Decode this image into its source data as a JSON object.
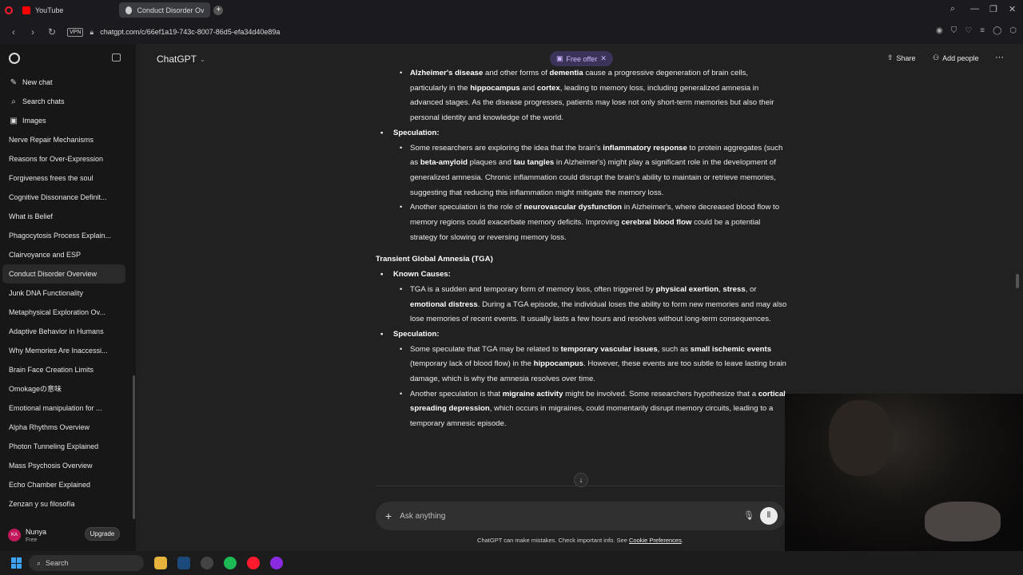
{
  "browser": {
    "tabs": [
      {
        "label": "YouTube",
        "active": false
      },
      {
        "label": "Conduct Disorder Overvie",
        "active": true
      }
    ],
    "new_tab": "+",
    "vpn_label": "VPN",
    "url": "chatgpt.com/c/66ef1a19-743c-8007-86d5-efa34d40e89a"
  },
  "sidebar": {
    "actions": [
      {
        "label": "New chat",
        "icon": "✎"
      },
      {
        "label": "Search chats",
        "icon": "⌕"
      },
      {
        "label": "Images",
        "icon": "▣"
      }
    ],
    "items": [
      "Nerve Repair Mechanisms",
      "Reasons for Over-Expression",
      "Forgiveness frees the soul",
      "Cognitive Dissonance Definit...",
      "What is Belief",
      "Phagocytosis Process Explain...",
      "Clairvoyance and ESP",
      "Conduct Disorder Overview",
      "Junk DNA Functionality",
      "Metaphysical Exploration Ov...",
      "Adaptive Behavior in Humans",
      "Why Memories Are Inaccessi...",
      "Brain Face Creation Limits",
      "Omokageの意味",
      "Emotional manipulation for ...",
      "Alpha Rhythms Overview",
      "Photon Tunneling Explained",
      "Mass Psychosis Overview",
      "Echo Chamber Explained",
      "Zenzan y su filosofía"
    ],
    "active_index": 7,
    "user": {
      "initials": "KA",
      "name": "Nunya",
      "plan": "Free"
    },
    "upgrade_label": "Upgrade"
  },
  "header": {
    "title": "ChatGPT",
    "offer_label": "Free offer",
    "share_label": "Share",
    "add_people_label": "Add people"
  },
  "content": {
    "known_causes_label": "Known Causes:",
    "speculation_label": "Speculation:",
    "alz_p1": "Alzheimer's disease",
    "alz_p2": " and other forms of ",
    "alz_p3": "dementia",
    "alz_p4": " cause a progressive degeneration of brain cells, particularly in the ",
    "alz_p5": "hippocampus",
    "alz_p6": " and ",
    "alz_p7": "cortex",
    "alz_p8": ", leading to memory loss, including generalized amnesia in advanced stages. As the disease progresses, patients may lose not only short-term memories but also their personal identity and knowledge of the world.",
    "spec1_p1": "Some researchers are exploring the idea that the brain's ",
    "spec1_p2": "inflammatory response",
    "spec1_p3": " to protein aggregates (such as ",
    "spec1_p4": "beta-amyloid",
    "spec1_p5": " plaques and ",
    "spec1_p6": "tau tangles",
    "spec1_p7": " in Alzheimer's) might play a significant role in the development of generalized amnesia. Chronic inflammation could disrupt the brain's ability to maintain or retrieve memories, suggesting that reducing this inflammation might mitigate the memory loss.",
    "spec2_p1": "Another speculation is the role of ",
    "spec2_p2": "neurovascular dysfunction",
    "spec2_p3": " in Alzheimer's, where decreased blood flow to memory regions could exacerbate memory deficits. Improving ",
    "spec2_p4": "cerebral blood flow",
    "spec2_p5": " could be a potential strategy for slowing or reversing memory loss.",
    "tga_heading": "Transient Global Amnesia (TGA)",
    "tga_p1": "TGA is a sudden and temporary form of memory loss, often triggered by ",
    "tga_p2": "physical exertion",
    "tga_p3": ", ",
    "tga_p4": "stress",
    "tga_p5": ", or ",
    "tga_p6": "emotional distress",
    "tga_p7": ". During a TGA episode, the individual loses the ability to form new memories and may also lose memories of recent events. It usually lasts a few hours and resolves without long-term consequences.",
    "tspec1_p1": "Some speculate that TGA may be related to ",
    "tspec1_p2": "temporary vascular issues",
    "tspec1_p3": ", such as ",
    "tspec1_p4": "small ischemic events",
    "tspec1_p5": " (temporary lack of blood flow) in the ",
    "tspec1_p6": "hippocampus",
    "tspec1_p7": ". However, these events are too subtle to leave lasting brain damage, which is why the amnesia resolves over time.",
    "tspec2_p1": "Another speculation is that ",
    "tspec2_p2": "migraine activity",
    "tspec2_p3": " might be involved. Some researchers hypothesize that a ",
    "tspec2_p4": "cortical spreading depression",
    "tspec2_p5": ", which occurs in migraines, could momentarily disrupt memory circuits, leading to a temporary amnesic episode."
  },
  "composer": {
    "placeholder": "Ask anything",
    "disclaimer": "ChatGPT can make mistakes. Check important info. See ",
    "cookie_link": "Cookie Preferences",
    "disclaimer_end": "."
  },
  "taskbar": {
    "search_label": "Search"
  },
  "colors": {
    "page_bg": "#212121",
    "sidebar_bg": "#171717",
    "offer_bg": "#3b3458",
    "offer_fg": "#cdb6ff"
  }
}
